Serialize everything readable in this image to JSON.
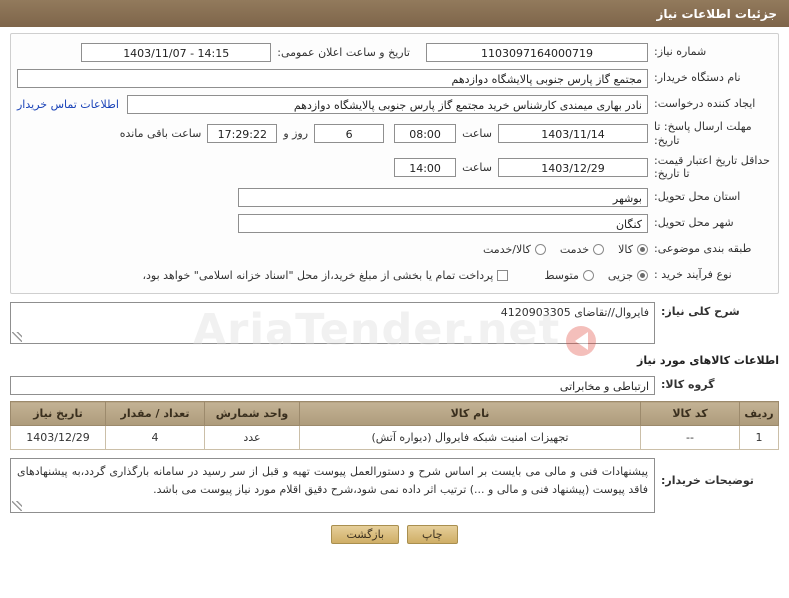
{
  "header": {
    "title": "جزئیات اطلاعات نیاز"
  },
  "fields": {
    "need_number_label": "شماره نیاز:",
    "need_number_value": "1103097164000719",
    "announce_datetime_label": "تاریخ و ساعت اعلان عمومی:",
    "announce_datetime_value": "1403/11/07 - 14:15",
    "buyer_org_label": "نام دستگاه خریدار:",
    "buyer_org_value": "مجتمع گاز پارس جنوبی  پالایشگاه دوازدهم",
    "requester_label": "ایجاد کننده درخواست:",
    "requester_value": "نادر بهاری میمندی کارشناس خرید مجتمع گاز پارس جنوبی  پالایشگاه دوازدهم",
    "contact_link": "اطلاعات تماس خریدار",
    "deadline_label": "مهلت ارسال پاسخ: تا تاریخ:",
    "deadline_date": "1403/11/14",
    "deadline_hour_label": "ساعت",
    "deadline_hour": "08:00",
    "remaining_days": "6",
    "remaining_days_label": "روز و",
    "remaining_time": "17:29:22",
    "remaining_suffix": "ساعت باقی مانده",
    "price_valid_label": "حداقل تاریخ اعتبار قیمت: تا تاریخ:",
    "price_valid_date": "1403/12/29",
    "price_valid_hour_label": "ساعت",
    "price_valid_hour": "14:00",
    "province_label": "استان محل تحویل:",
    "province_value": "بوشهر",
    "city_label": "شهر محل تحویل:",
    "city_value": "کنگان",
    "subject_label": "طبقه بندی موضوعی:",
    "subject_options": [
      "کالا",
      "خدمت",
      "کالا/خدمت"
    ],
    "subject_selected": "کالا",
    "process_label": "نوع فرآیند خرید :",
    "process_options": [
      "جزیی",
      "متوسط"
    ],
    "process_selected": "جزیی",
    "payment_checkbox_text": "پرداخت تمام یا بخشی از مبلغ خرید،از محل \"اسناد خزانه اسلامی\" خواهد بود،",
    "payment_checked": false
  },
  "summary": {
    "label": "شرح کلی نیاز:",
    "value": "فایروال//تقاضای 4120903305"
  },
  "goods": {
    "section_title": "اطلاعات کالاهای مورد نیاز",
    "group_label": "گروه کالا:",
    "group_value": "ارتباطی و مخابراتی",
    "table": {
      "headers": [
        "ردیف",
        "کد کالا",
        "نام کالا",
        "واحد شمارش",
        "تعداد / مقدار",
        "تاریخ نیاز"
      ],
      "rows": [
        [
          "1",
          "--",
          "تجهیزات امنیت شبکه فایروال (دیواره آتش)",
          "عدد",
          "4",
          "1403/12/29"
        ]
      ]
    }
  },
  "notes": {
    "label": "توضیحات خریدار:",
    "value": "پیشنهادات فنی و مالی می بایست بر اساس شرح و دستورالعمل پیوست تهیه و قبل از سر رسید در سامانه بارگذاری گردد،به پیشنهادهای فاقد پیوست (پیشنهاد فنی و مالی و ...) ترتیب اثر داده نمی شود،شرح دقیق اقلام مورد نیاز پیوست می باشد."
  },
  "footer": {
    "back_button": "بازگشت",
    "print_button": "چاپ"
  },
  "watermark": {
    "text": "AriaTender.net"
  }
}
